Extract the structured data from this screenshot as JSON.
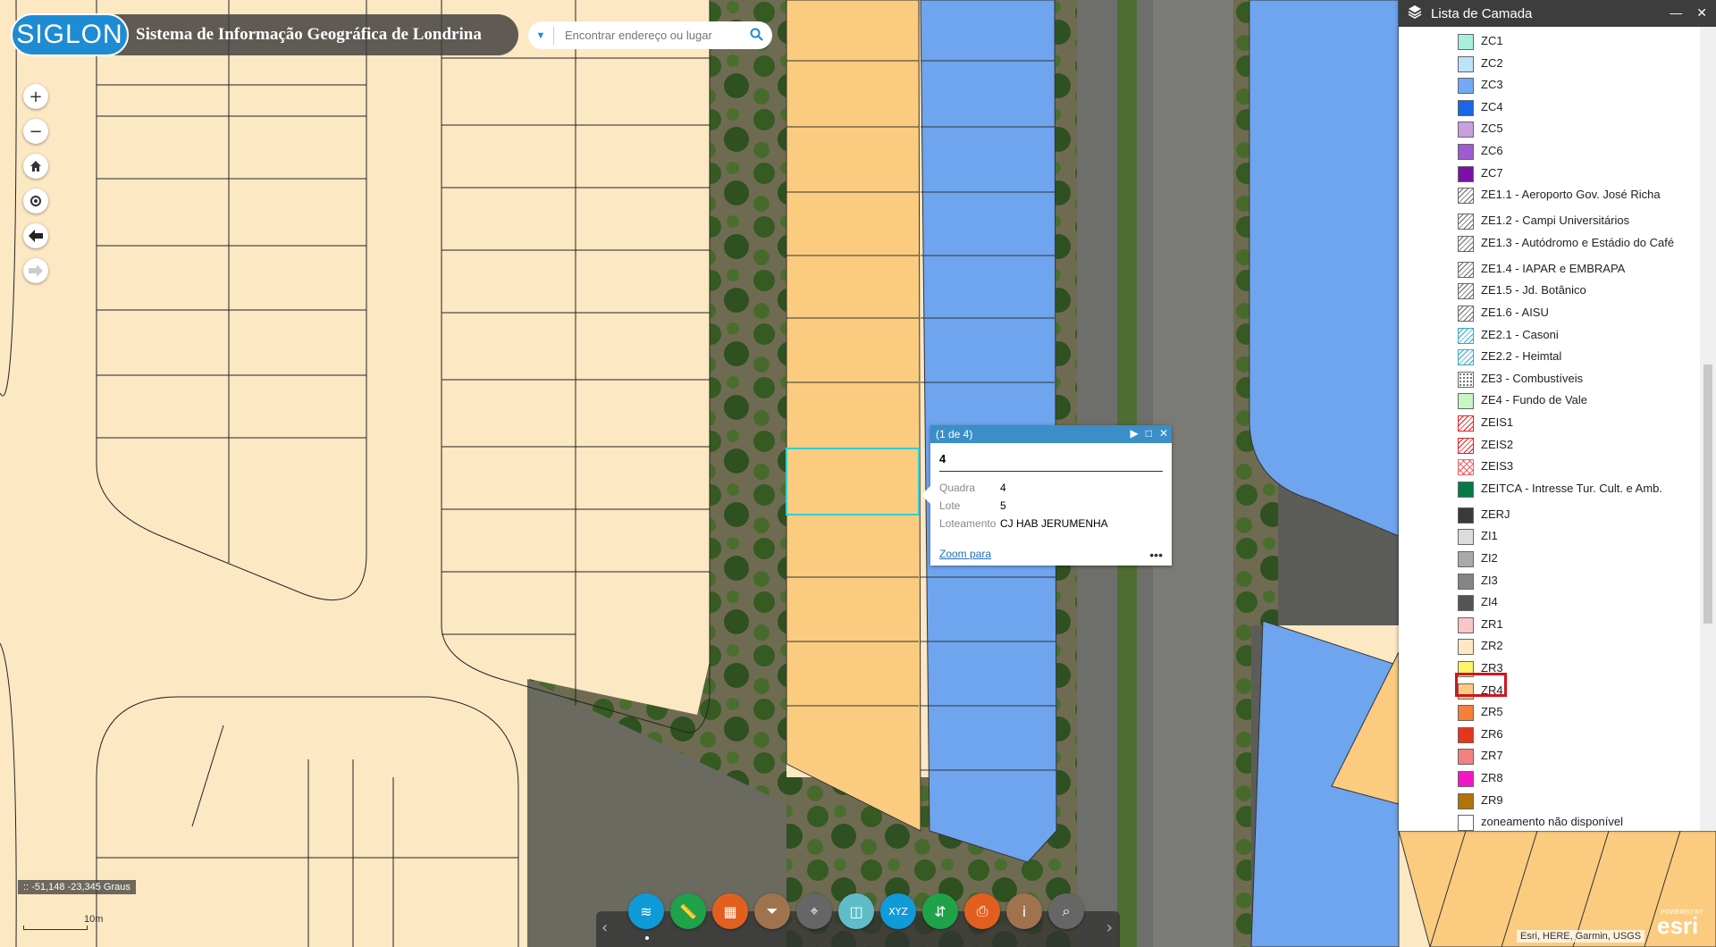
{
  "header": {
    "logo": "SIGLON",
    "title": "Sistema de Informação Geográfica de Londrina"
  },
  "search": {
    "placeholder": "Encontrar endereço ou lugar"
  },
  "map_controls": [
    {
      "name": "zoom-in-button",
      "glyph": "+"
    },
    {
      "name": "zoom-out-button",
      "glyph": "−"
    },
    {
      "name": "home-button",
      "glyph": "⌂"
    },
    {
      "name": "locate-button",
      "glyph": "◎"
    },
    {
      "name": "back-button",
      "glyph": "🡄"
    },
    {
      "name": "forward-button",
      "glyph": "🡆"
    }
  ],
  "popup": {
    "counter": "(1 de 4)",
    "title": "4",
    "fields": [
      {
        "key": "Quadra",
        "value": "4"
      },
      {
        "key": "Lote",
        "value": "5"
      },
      {
        "key": "Loteamento",
        "value": "CJ HAB JERUMENHA"
      }
    ],
    "zoom_link": "Zoom para",
    "more": "•••"
  },
  "layers": {
    "title": "Lista de Camada",
    "items": [
      {
        "label": "ZC1",
        "color": "#a9f0dc",
        "style": "fill"
      },
      {
        "label": "ZC2",
        "color": "#bde3f7",
        "style": "fill"
      },
      {
        "label": "ZC3",
        "color": "#74a9f4",
        "style": "fill"
      },
      {
        "label": "ZC4",
        "color": "#1867e6",
        "style": "fill"
      },
      {
        "label": "ZC5",
        "color": "#c7a0e0",
        "style": "fill"
      },
      {
        "label": "ZC6",
        "color": "#a05ad2",
        "style": "fill"
      },
      {
        "label": "ZC7",
        "color": "#7d10a8",
        "style": "fill"
      },
      {
        "label": "ZE1.1 - Aeroporto Gov. José Richa",
        "color": "#666666",
        "style": "hatch"
      },
      {
        "label": "ZE1.2 - Campi Universitários",
        "color": "#666666",
        "style": "hatch"
      },
      {
        "label": "ZE1.3 - Autódromo e Estádio do Café",
        "color": "#666666",
        "style": "hatch"
      },
      {
        "label": "ZE1.4 - IAPAR e EMBRAPA",
        "color": "#666666",
        "style": "hatch"
      },
      {
        "label": "ZE1.5 - Jd. Botânico",
        "color": "#666666",
        "style": "hatch"
      },
      {
        "label": "ZE1.6 - AISU",
        "color": "#666666",
        "style": "hatch"
      },
      {
        "label": "ZE2.1 - Casoni",
        "color": "#3aa6c6",
        "style": "hatchb"
      },
      {
        "label": "ZE2.2 - Heimtal",
        "color": "#3aa6c6",
        "style": "hatchb"
      },
      {
        "label": "ZE3 - Combustíveis",
        "color": "#666666",
        "style": "dots"
      },
      {
        "label": "ZE4 - Fundo de Vale",
        "color": "#c9f5c4",
        "style": "fill"
      },
      {
        "label": "ZEIS1",
        "color": "#dd2222",
        "style": "hatchr"
      },
      {
        "label": "ZEIS2",
        "color": "#dd2222",
        "style": "hatchr"
      },
      {
        "label": "ZEIS3",
        "color": "#ee6666",
        "style": "cross"
      },
      {
        "label": "ZEITCA - Intresse Tur. Cult. e Amb.",
        "color": "#047a45",
        "style": "fill"
      },
      {
        "label": "ZERJ",
        "color": "#3a3a3a",
        "style": "fill"
      },
      {
        "label": "ZI1",
        "color": "#dcdcdc",
        "style": "fill"
      },
      {
        "label": "ZI2",
        "color": "#aaaaaa",
        "style": "fill"
      },
      {
        "label": "ZI3",
        "color": "#858585",
        "style": "fill"
      },
      {
        "label": "ZI4",
        "color": "#545454",
        "style": "fill"
      },
      {
        "label": "ZR1",
        "color": "#f9c6c6",
        "style": "fill"
      },
      {
        "label": "ZR2",
        "color": "#fde8c4",
        "style": "fill"
      },
      {
        "label": "ZR3",
        "color": "#fbf56a",
        "style": "fill"
      },
      {
        "label": "ZR4",
        "color": "#fbcc80",
        "style": "fill"
      },
      {
        "label": "ZR5",
        "color": "#f77f3a",
        "style": "fill"
      },
      {
        "label": "ZR6",
        "color": "#e8341c",
        "style": "fill"
      },
      {
        "label": "ZR7",
        "color": "#f48080",
        "style": "fill"
      },
      {
        "label": "ZR8",
        "color": "#f216c4",
        "style": "fill"
      },
      {
        "label": "ZR9",
        "color": "#b07408",
        "style": "fill"
      },
      {
        "label": "zoneamento não disponível",
        "color": "#ffffff",
        "style": "fill"
      }
    ]
  },
  "coords": "-51,148 -23,345 Graus",
  "coords_icon": "::",
  "scale": "10m",
  "attribution": "Esri, HERE, Garmin, USGS",
  "esri": {
    "powered": "POWERED BY",
    "brand": "esri"
  },
  "toolbar": [
    {
      "name": "layers-tool",
      "color": "#0f9ad8",
      "glyph": "≋"
    },
    {
      "name": "measure-tool",
      "color": "#1fa24a",
      "glyph": "📏"
    },
    {
      "name": "basemap-tool",
      "color": "#e35f1f",
      "glyph": "▦"
    },
    {
      "name": "filter-tool",
      "color": "#a0734f",
      "glyph": "⏷"
    },
    {
      "name": "location-tool",
      "color": "#666666",
      "glyph": "⌖"
    },
    {
      "name": "swipe-tool",
      "color": "#5fbcc8",
      "glyph": "◫"
    },
    {
      "name": "xyz-tool",
      "color": "#0f9ad8",
      "glyph": "XYZ"
    },
    {
      "name": "share-tool",
      "color": "#1fa24a",
      "glyph": "⇵"
    },
    {
      "name": "print-tool",
      "color": "#e35f1f",
      "glyph": "⎙"
    },
    {
      "name": "info-tool",
      "color": "#a0734f",
      "glyph": "i"
    },
    {
      "name": "query-tool",
      "color": "#666666",
      "glyph": "⌕"
    }
  ]
}
